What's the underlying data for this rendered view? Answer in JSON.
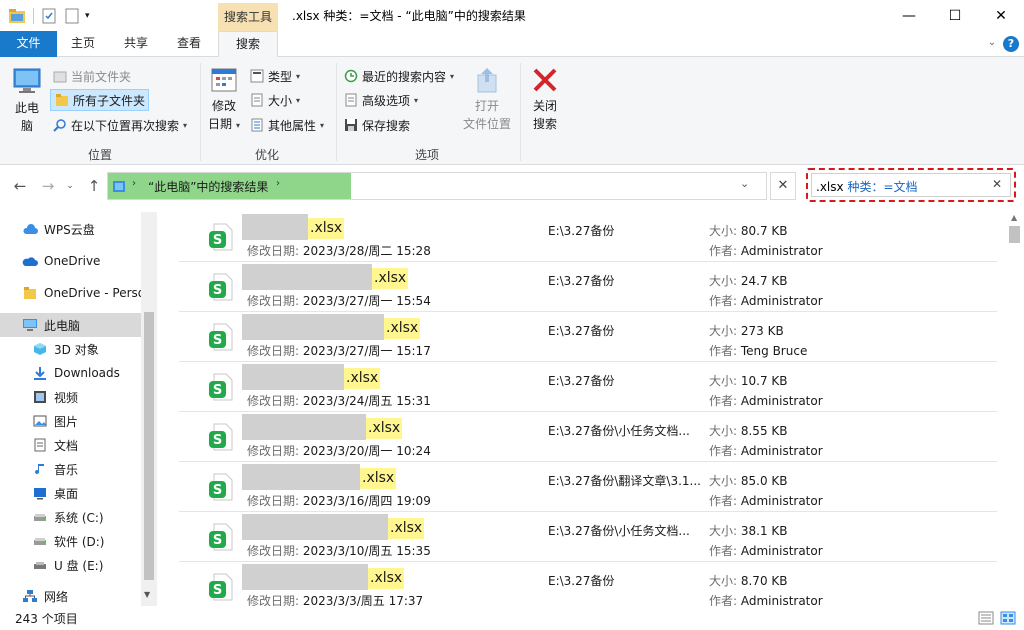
{
  "window": {
    "title": ".xlsx 种类：=文档 - “此电脑”中的搜索结果",
    "tool_tab": "搜索工具",
    "min_icon": "—",
    "max_icon": "☐",
    "close_icon": "✕"
  },
  "ribbon_tabs": [
    "文件",
    "主页",
    "共享",
    "查看",
    "搜索"
  ],
  "ribbon": {
    "location_group": {
      "label": "位置",
      "big": "此电\n脑",
      "current_folder": "当前文件夹",
      "all_subfolders": "所有子文件夹",
      "search_again": "在以下位置再次搜索"
    },
    "refine_group": {
      "label": "优化",
      "date_modified_line1": "修改",
      "date_modified_line2": "日期",
      "kind": "类型",
      "size": "大小",
      "other_props": "其他属性"
    },
    "options_group": {
      "label": "选项",
      "recent_searches": "最近的搜索内容",
      "advanced": "高级选项",
      "save_search": "保存搜索",
      "open_location_line1": "打开",
      "open_location_line2": "文件位置",
      "close_line1": "关闭",
      "close_line2": "搜索"
    }
  },
  "address": {
    "path": "“此电脑”中的搜索结果",
    "search_query_ext": ".xlsx",
    "search_query_kind": "种类：=文档"
  },
  "nav_items": [
    {
      "label": "WPS云盘",
      "icon": "cloud-icon"
    },
    {
      "label": "OneDrive",
      "icon": "onedrive-icon"
    },
    {
      "label": "OneDrive - Personal",
      "icon": "folder-icon"
    },
    {
      "label": "此电脑",
      "icon": "computer-icon"
    },
    {
      "label": "3D 对象",
      "icon": "3d-objects-icon"
    },
    {
      "label": "Downloads",
      "icon": "download-icon"
    },
    {
      "label": "视频",
      "icon": "video-icon"
    },
    {
      "label": "图片",
      "icon": "picture-icon"
    },
    {
      "label": "文档",
      "icon": "document-icon"
    },
    {
      "label": "音乐",
      "icon": "music-icon"
    },
    {
      "label": "桌面",
      "icon": "desktop-icon"
    },
    {
      "label": "系统 (C:)",
      "icon": "drive-icon"
    },
    {
      "label": "软件 (D:)",
      "icon": "drive-icon"
    },
    {
      "label": "U 盘 (E:)",
      "icon": "usb-drive-icon"
    },
    {
      "label": "网络",
      "icon": "network-icon"
    }
  ],
  "labels": {
    "modified": "修改日期: ",
    "size": "大小: ",
    "author": "作者: "
  },
  "files": [
    {
      "ext": ".xlsx",
      "modified": "2023/3/28/周二 15:28",
      "location": "E:\\3.27备份",
      "size": "80.7 KB",
      "author": "Administrator"
    },
    {
      "ext": ".xlsx",
      "modified": "2023/3/27/周一 15:54",
      "location": "E:\\3.27备份",
      "size": "24.7 KB",
      "author": "Administrator"
    },
    {
      "ext": ".xlsx",
      "modified": "2023/3/27/周一 15:17",
      "location": "E:\\3.27备份",
      "size": "273 KB",
      "author": "Teng Bruce"
    },
    {
      "ext": ".xlsx",
      "modified": "2023/3/24/周五 15:31",
      "location": "E:\\3.27备份",
      "size": "10.7 KB",
      "author": "Administrator"
    },
    {
      "ext": ".xlsx",
      "modified": "2023/3/20/周一 10:24",
      "location": "E:\\3.27备份\\小任务文档...",
      "size": "8.55 KB",
      "author": "Administrator"
    },
    {
      "ext": ".xlsx",
      "modified": "2023/3/16/周四 19:09",
      "location": "E:\\3.27备份\\翻译文章\\3.1...",
      "size": "85.0 KB",
      "author": "Administrator"
    },
    {
      "ext": ".xlsx",
      "modified": "2023/3/10/周五 15:35",
      "location": "E:\\3.27备份\\小任务文档...",
      "size": "38.1 KB",
      "author": "Administrator"
    },
    {
      "ext": ".xlsx",
      "modified": "2023/3/3/周五 17:37",
      "location": "E:\\3.27备份",
      "size": "8.70 KB",
      "author": "Administrator"
    }
  ],
  "status": {
    "count": "243 个项目"
  },
  "colors": {
    "accent": "#1979ca",
    "tool_tab": "#f7e1b3",
    "highlight": "#fff68f",
    "address_fill": "#8fd68a",
    "search_outline": "#d7191c"
  }
}
